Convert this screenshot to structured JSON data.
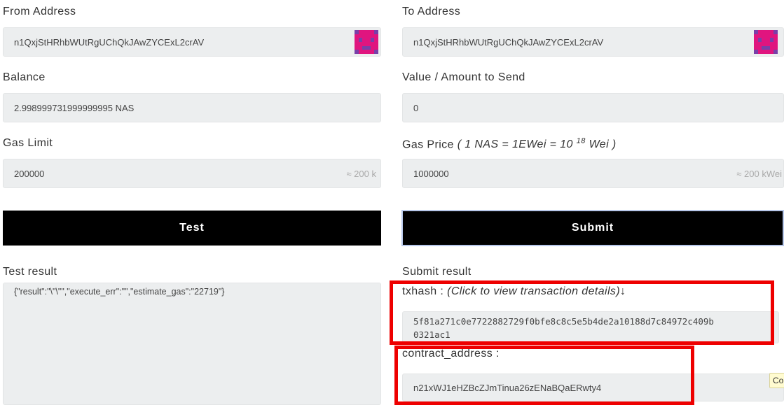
{
  "from": {
    "label": "From Address",
    "value": "n1QxjStHRhbWUtRgUChQkJAwZYCExL2crAV",
    "identicon": "identicon-icon"
  },
  "to": {
    "label": "To Address",
    "value": "n1QxjStHRhbWUtRgUChQkJAwZYCExL2crAV",
    "identicon": "identicon-icon"
  },
  "balance": {
    "label": "Balance",
    "value": "2.998999731999999995 NAS"
  },
  "value": {
    "label": "Value / Amount to Send",
    "value": "0"
  },
  "gas_limit": {
    "label": "Gas Limit",
    "value": "200000",
    "hint": "≈ 200 k"
  },
  "gas_price": {
    "label": "Gas Price",
    "note_prefix": "( 1 NAS = 1EWei = 10 ",
    "note_sup": "18",
    "note_suffix": " Wei )",
    "value": "1000000",
    "hint": "≈ 200 kWei"
  },
  "buttons": {
    "test": "Test",
    "submit": "Submit"
  },
  "test_result": {
    "label": "Test result",
    "value": "{\"result\":\"\\\"\\\"\",\"execute_err\":\"\",\"estimate_gas\":\"22719\"}"
  },
  "submit_result": {
    "label": "Submit result",
    "txhash_label": "txhash :",
    "txhash_hint": "(Click to view transaction details)↓",
    "txhash_line1": "5f81a271c0e7722882729f0bfe8c8c5e5b4de2a10188d7c84972c409b",
    "txhash_line2": "0321ac1",
    "contract_label": "contract_address :",
    "contract_value": "n21xWJ1eHZBcZJmTinua26zENaBQaERwty4"
  },
  "tooltip": "Co",
  "colors": {
    "highlight": "#ee0000",
    "button": "#000000",
    "field": "#eceeef"
  }
}
